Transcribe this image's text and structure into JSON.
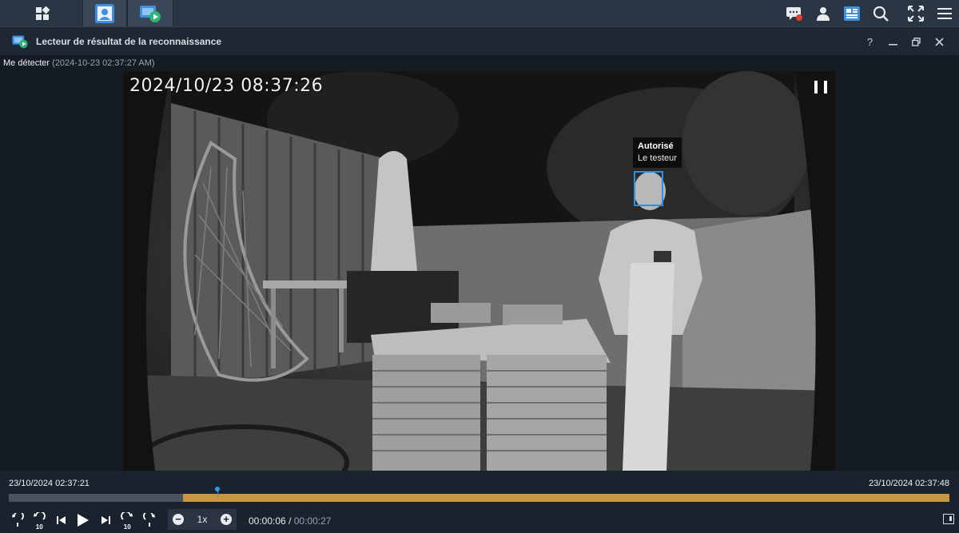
{
  "window": {
    "title": "Lecteur de résultat de la reconnaissance"
  },
  "event": {
    "name": "Me détecter",
    "timestamp": "(2024-10-23 02:37:27 AM)"
  },
  "video": {
    "osd_timestamp": "2024/10/23 08:37:26",
    "face": {
      "status": "Autorisé",
      "person": "Le testeur",
      "box_color": "#2d8fe0"
    }
  },
  "timeline": {
    "start_label": "23/10/2024 02:37:21",
    "end_label": "23/10/2024 02:37:48",
    "buffered_start_fraction": 0.185,
    "playhead_fraction": 0.222,
    "fill_color": "#c8963f"
  },
  "playback": {
    "speed": "1x",
    "elapsed": "00:00:06",
    "separator": "/",
    "total": "00:00:27",
    "skip_seconds": "10"
  },
  "icons": {
    "taskbar": [
      "main-menu-icon",
      "face-recognition-app-icon",
      "surveillance-playback-app-icon"
    ],
    "tray": [
      "chat-icon",
      "user-icon",
      "widgets-icon",
      "search-icon",
      "fullscreen-icon",
      "menu-icon"
    ],
    "window": [
      "help-icon",
      "minimize-icon",
      "restore-icon",
      "close-icon"
    ]
  }
}
